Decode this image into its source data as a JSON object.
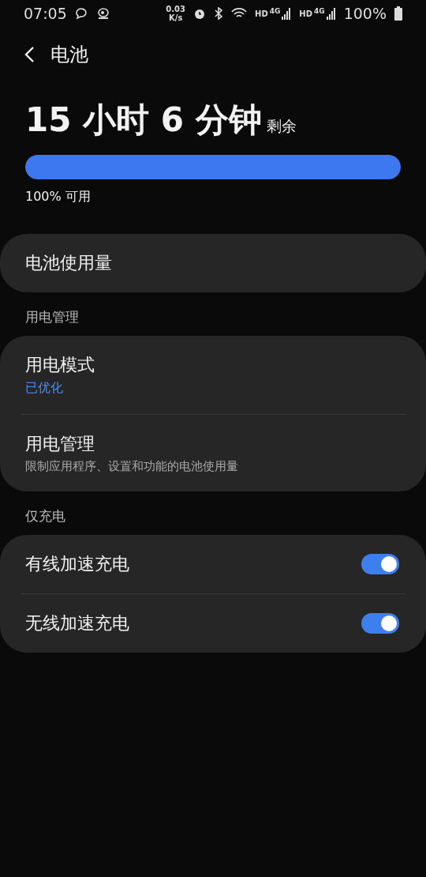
{
  "status_bar": {
    "time": "07:05",
    "speed_value": "0.03",
    "speed_unit": "K/s",
    "networks": [
      {
        "label": "HD",
        "type": "4G"
      },
      {
        "label": "HD",
        "type": "4G"
      }
    ],
    "battery": "100%"
  },
  "header": {
    "title": "电池"
  },
  "summary": {
    "time": "15 小时 6 分钟",
    "suffix": "剩余",
    "level": 1,
    "available": "100% 可用"
  },
  "sections": [
    {
      "items": [
        {
          "kind": "nav",
          "title": "电池使用量"
        }
      ]
    },
    {
      "header": "用电管理",
      "items": [
        {
          "kind": "nav",
          "title": "用电模式",
          "value": "已优化"
        },
        {
          "kind": "nav",
          "title": "用电管理",
          "description": "限制应用程序、设置和功能的电池使用量"
        }
      ]
    },
    {
      "header": "仅充电",
      "items": [
        {
          "kind": "toggle",
          "title": "有线加速充电",
          "on": true
        },
        {
          "kind": "toggle",
          "title": "无线加速充电",
          "on": true
        }
      ]
    }
  ]
}
